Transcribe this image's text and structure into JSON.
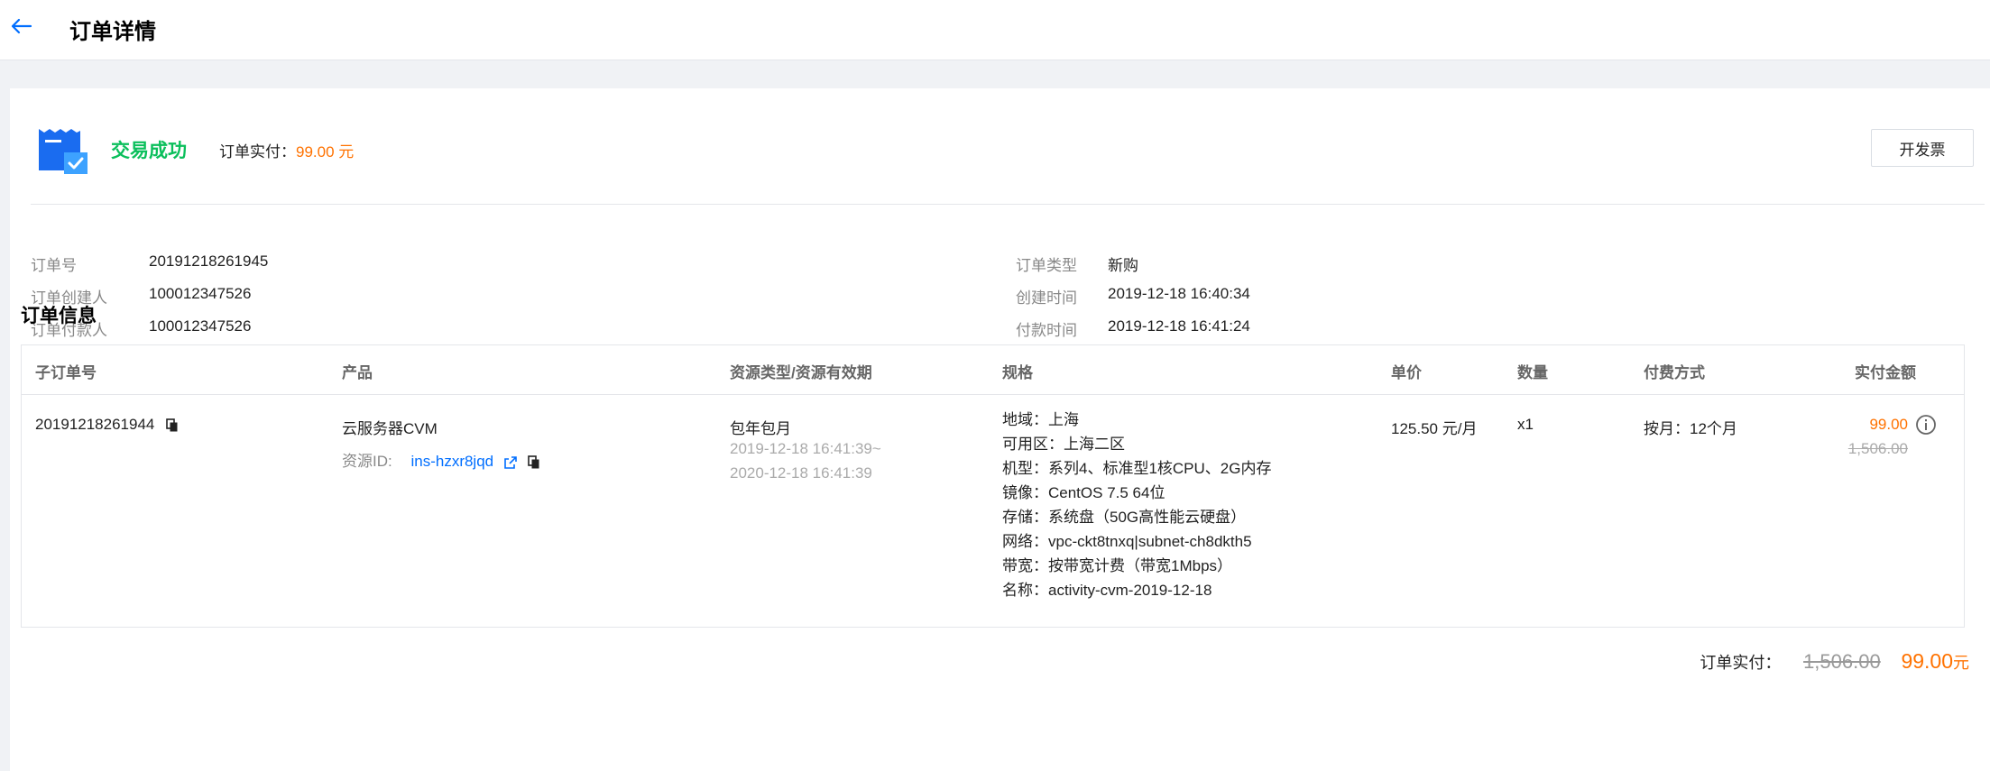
{
  "header": {
    "title": "订单详情"
  },
  "status": {
    "text": "交易成功",
    "paid_label": "订单实付：",
    "paid_amount": "99.00 元",
    "invoice_button": "开发票"
  },
  "order_meta": {
    "left": [
      {
        "label": "订单号",
        "value": "20191218261945"
      },
      {
        "label": "订单创建人",
        "value": "100012347526"
      },
      {
        "label": "订单付款人",
        "value": "100012347526"
      }
    ],
    "right": [
      {
        "label": "订单类型",
        "value": "新购"
      },
      {
        "label": "创建时间",
        "value": "2019-12-18 16:40:34"
      },
      {
        "label": "付款时间",
        "value": "2019-12-18 16:41:24"
      }
    ]
  },
  "order_info": {
    "title": "订单信息",
    "columns": [
      "子订单号",
      "产品",
      "资源类型/资源有效期",
      "规格",
      "单价",
      "数量",
      "付费方式",
      "实付金额"
    ],
    "row": {
      "sub_order_id": "20191218261944",
      "product": "云服务器CVM",
      "resource_id_label": "资源ID:",
      "resource_id": "ins-hzxr8jqd",
      "resource_type": "包年包月",
      "validity_start": "2019-12-18 16:41:39~",
      "validity_end": "2020-12-18 16:41:39",
      "specs": [
        "地域：上海",
        "可用区：上海二区",
        "机型：系列4、标准型1核CPU、2G内存",
        "镜像：CentOS 7.5 64位",
        "存储：系统盘（50G高性能云硬盘）",
        "网络：vpc-ckt8tnxq|subnet-ch8dkth5",
        "带宽：按带宽计费（带宽1Mbps）",
        "名称：activity-cvm-2019-12-18"
      ],
      "unit_price": "125.50 元/月",
      "quantity": "x1",
      "payment_method": "按月：12个月",
      "paid_amount": "99.00",
      "original_amount": "1,506.00"
    }
  },
  "footer": {
    "label": "订单实付：",
    "original": "1,506.00",
    "amount": "99.00",
    "unit": "元"
  },
  "colors": {
    "accent": "#006eff",
    "success": "#0abf5b",
    "price": "#ff7200"
  },
  "icons": [
    "back-arrow-icon",
    "receipt-check-icon",
    "copy-icon",
    "external-link-icon",
    "info-icon"
  ]
}
